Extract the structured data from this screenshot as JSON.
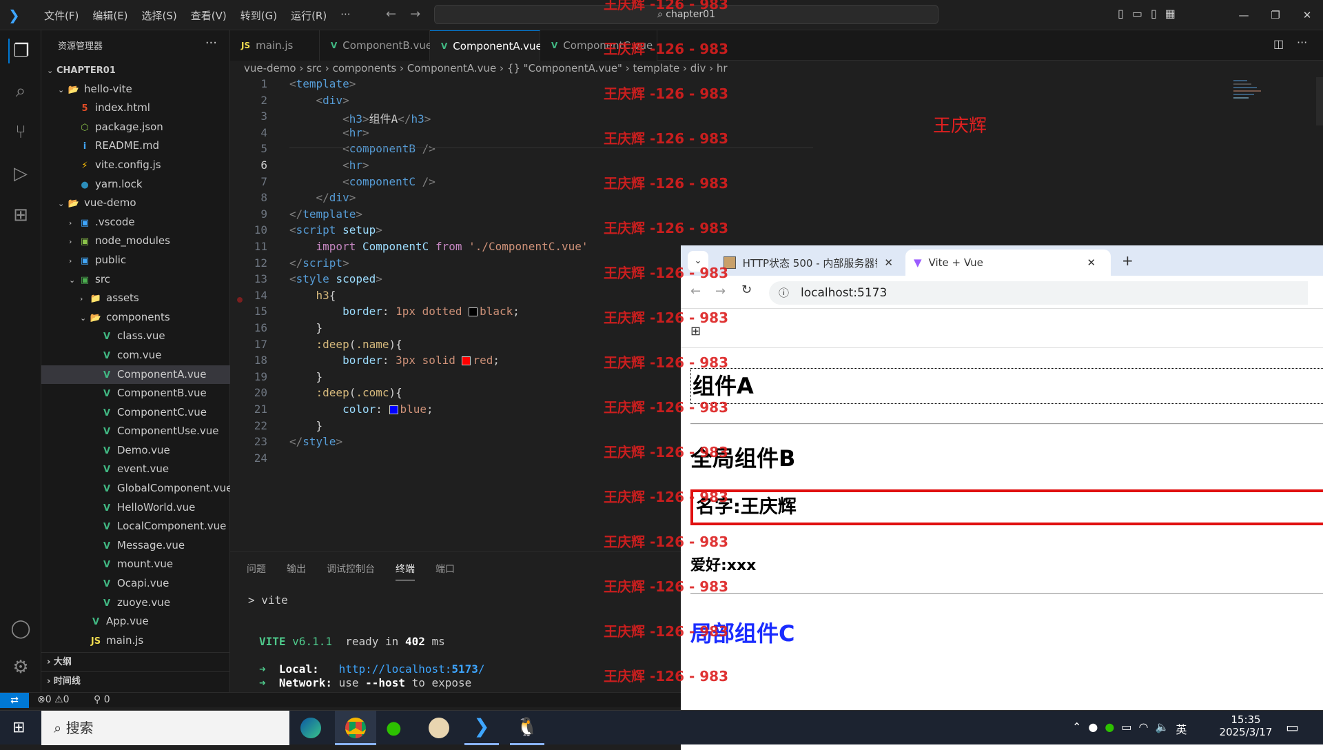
{
  "titlebar": {
    "menu": [
      "文件(F)",
      "编辑(E)",
      "选择(S)",
      "查看(V)",
      "转到(G)",
      "运行(R)",
      "···"
    ],
    "search": "chapter01"
  },
  "sidebar": {
    "title": "资源管理器",
    "outline": "大纲",
    "timeline": "时间线",
    "tree": [
      {
        "depth": 0,
        "arrow": "v",
        "icon": "",
        "label": "CHAPTER01",
        "bold": true
      },
      {
        "depth": 1,
        "arrow": "v",
        "icon": "folder-open-icon",
        "label": "hello-vite"
      },
      {
        "depth": 2,
        "arrow": "",
        "icon": "html-icon",
        "label": "index.html"
      },
      {
        "depth": 2,
        "arrow": "",
        "icon": "json-icon",
        "label": "package.json"
      },
      {
        "depth": 2,
        "arrow": "",
        "icon": "info-icon",
        "label": "README.md"
      },
      {
        "depth": 2,
        "arrow": "",
        "icon": "vite-icon",
        "label": "vite.config.js"
      },
      {
        "depth": 2,
        "arrow": "",
        "icon": "yarn-icon",
        "label": "yarn.lock"
      },
      {
        "depth": 1,
        "arrow": "v",
        "icon": "folder-open-icon",
        "label": "vue-demo"
      },
      {
        "depth": 2,
        "arrow": ">",
        "icon": "folder-vscode-icon",
        "label": ".vscode"
      },
      {
        "depth": 2,
        "arrow": ">",
        "icon": "folder-node-icon",
        "label": "node_modules"
      },
      {
        "depth": 2,
        "arrow": ">",
        "icon": "folder-public-icon",
        "label": "public"
      },
      {
        "depth": 2,
        "arrow": "v",
        "icon": "folder-src-icon",
        "label": "src"
      },
      {
        "depth": 3,
        "arrow": ">",
        "icon": "folder-icon",
        "label": "assets"
      },
      {
        "depth": 3,
        "arrow": "v",
        "icon": "folder-open-icon",
        "label": "components"
      },
      {
        "depth": 4,
        "arrow": "",
        "icon": "vue-icon",
        "label": "class.vue"
      },
      {
        "depth": 4,
        "arrow": "",
        "icon": "vue-icon",
        "label": "com.vue"
      },
      {
        "depth": 4,
        "arrow": "",
        "icon": "vue-icon",
        "label": "ComponentA.vue",
        "selected": true
      },
      {
        "depth": 4,
        "arrow": "",
        "icon": "vue-icon",
        "label": "ComponentB.vue"
      },
      {
        "depth": 4,
        "arrow": "",
        "icon": "vue-icon",
        "label": "ComponentC.vue"
      },
      {
        "depth": 4,
        "arrow": "",
        "icon": "vue-icon",
        "label": "ComponentUse.vue"
      },
      {
        "depth": 4,
        "arrow": "",
        "icon": "vue-icon",
        "label": "Demo.vue"
      },
      {
        "depth": 4,
        "arrow": "",
        "icon": "vue-icon",
        "label": "event.vue"
      },
      {
        "depth": 4,
        "arrow": "",
        "icon": "vue-icon",
        "label": "GlobalComponent.vue"
      },
      {
        "depth": 4,
        "arrow": "",
        "icon": "vue-icon",
        "label": "HelloWorld.vue"
      },
      {
        "depth": 4,
        "arrow": "",
        "icon": "vue-icon",
        "label": "LocalComponent.vue"
      },
      {
        "depth": 4,
        "arrow": "",
        "icon": "vue-icon",
        "label": "Message.vue"
      },
      {
        "depth": 4,
        "arrow": "",
        "icon": "vue-icon",
        "label": "mount.vue"
      },
      {
        "depth": 4,
        "arrow": "",
        "icon": "vue-icon",
        "label": "Ocapi.vue"
      },
      {
        "depth": 4,
        "arrow": "",
        "icon": "vue-icon",
        "label": "zuoye.vue"
      },
      {
        "depth": 3,
        "arrow": "",
        "icon": "vue-icon",
        "label": "App.vue"
      },
      {
        "depth": 3,
        "arrow": "",
        "icon": "js-icon",
        "label": "main.js"
      }
    ]
  },
  "tabs": [
    {
      "icon": "js-icon",
      "label": "main.js",
      "active": false
    },
    {
      "icon": "vue-icon",
      "label": "ComponentB.vue",
      "active": false
    },
    {
      "icon": "vue-icon",
      "label": "ComponentA.vue",
      "active": true,
      "close": "×"
    },
    {
      "icon": "vue-icon",
      "label": "ComponentC.vue",
      "active": false
    }
  ],
  "breadcrumb": [
    "vue-demo",
    "src",
    "components",
    "ComponentA.vue",
    "{} \"ComponentA.vue\"",
    "template",
    "div",
    "hr"
  ],
  "code": [
    [
      [
        "t-tag",
        "<"
      ],
      [
        "t-n",
        "template"
      ],
      [
        "t-tag",
        ">"
      ]
    ],
    [
      [
        "t-t",
        "    "
      ],
      [
        "t-tag",
        "<"
      ],
      [
        "t-n",
        "div"
      ],
      [
        "t-tag",
        ">"
      ]
    ],
    [
      [
        "t-t",
        "        "
      ],
      [
        "t-tag",
        "<"
      ],
      [
        "t-n",
        "h3"
      ],
      [
        "t-tag",
        ">"
      ],
      [
        "t-t",
        "组件A"
      ],
      [
        "t-tag",
        "</"
      ],
      [
        "t-n",
        "h3"
      ],
      [
        "t-tag",
        ">"
      ]
    ],
    [
      [
        "t-t",
        "        "
      ],
      [
        "t-tag",
        "<"
      ],
      [
        "t-n",
        "hr"
      ],
      [
        "t-tag",
        ">"
      ]
    ],
    [
      [
        "t-t",
        "        "
      ],
      [
        "t-tag",
        "<"
      ],
      [
        "t-n",
        "componentB"
      ],
      [
        "t-tag",
        " />"
      ]
    ],
    [
      [
        "t-t",
        "        "
      ],
      [
        "t-tag",
        "<"
      ],
      [
        "t-n",
        "hr"
      ],
      [
        "t-tag",
        ">"
      ]
    ],
    [
      [
        "t-t",
        "        "
      ],
      [
        "t-tag",
        "<"
      ],
      [
        "t-n",
        "componentC"
      ],
      [
        "t-tag",
        " />"
      ]
    ],
    [
      [
        "t-t",
        "    "
      ],
      [
        "t-tag",
        "</"
      ],
      [
        "t-n",
        "div"
      ],
      [
        "t-tag",
        ">"
      ]
    ],
    [
      [
        "t-tag",
        "</"
      ],
      [
        "t-n",
        "template"
      ],
      [
        "t-tag",
        ">"
      ]
    ],
    [
      [
        "t-tag",
        "<"
      ],
      [
        "t-n",
        "script"
      ],
      [
        "t-t",
        " "
      ],
      [
        "t-a",
        "setup"
      ],
      [
        "t-tag",
        ">"
      ]
    ],
    [
      [
        "t-t",
        "    "
      ],
      [
        "t-k",
        "import"
      ],
      [
        "t-t",
        " "
      ],
      [
        "t-a",
        "ComponentC"
      ],
      [
        "t-t",
        " "
      ],
      [
        "t-k",
        "from"
      ],
      [
        "t-t",
        " "
      ],
      [
        "t-s",
        "'./ComponentC.vue'"
      ]
    ],
    [
      [
        "t-tag",
        "</"
      ],
      [
        "t-n",
        "script"
      ],
      [
        "t-tag",
        ">"
      ]
    ],
    [
      [
        "t-tag",
        "<"
      ],
      [
        "t-n",
        "style"
      ],
      [
        "t-t",
        " "
      ],
      [
        "t-a",
        "scoped"
      ],
      [
        "t-tag",
        ">"
      ]
    ],
    [
      [
        "t-t",
        "    "
      ],
      [
        "t-y",
        "h3"
      ],
      [
        "t-t",
        "{"
      ]
    ],
    [
      [
        "t-t",
        "        "
      ],
      [
        "t-a",
        "border"
      ],
      [
        "t-t",
        ": "
      ],
      [
        "t-s",
        "1px"
      ],
      [
        "t-t",
        " "
      ],
      [
        "t-s",
        "dotted"
      ],
      [
        "t-t",
        " "
      ],
      [
        "sw",
        "#000000"
      ],
      [
        "t-s",
        "black"
      ],
      [
        "t-t",
        ";"
      ]
    ],
    [
      [
        "t-t",
        "    }"
      ]
    ],
    [
      [
        "t-t",
        "    "
      ],
      [
        "t-y",
        ":deep"
      ],
      [
        "t-t",
        "("
      ],
      [
        "t-y",
        ".name"
      ],
      [
        "t-t",
        "){"
      ]
    ],
    [
      [
        "t-t",
        "        "
      ],
      [
        "t-a",
        "border"
      ],
      [
        "t-t",
        ": "
      ],
      [
        "t-s",
        "3px"
      ],
      [
        "t-t",
        " "
      ],
      [
        "t-s",
        "solid"
      ],
      [
        "t-t",
        " "
      ],
      [
        "sw",
        "#ff0000"
      ],
      [
        "t-s",
        "red"
      ],
      [
        "t-t",
        ";"
      ]
    ],
    [
      [
        "t-t",
        "    }"
      ]
    ],
    [
      [
        "t-t",
        "    "
      ],
      [
        "t-y",
        ":deep"
      ],
      [
        "t-t",
        "("
      ],
      [
        "t-y",
        ".comc"
      ],
      [
        "t-t",
        "){"
      ]
    ],
    [
      [
        "t-t",
        "        "
      ],
      [
        "t-a",
        "color"
      ],
      [
        "t-t",
        ": "
      ],
      [
        "sw",
        "#0000ff"
      ],
      [
        "t-s",
        "blue"
      ],
      [
        "t-t",
        ";"
      ]
    ],
    [
      [
        "t-t",
        "    }"
      ]
    ],
    [
      [
        "t-tag",
        "</"
      ],
      [
        "t-n",
        "style"
      ],
      [
        "t-tag",
        ">"
      ]
    ],
    [
      [
        "t-t",
        ""
      ]
    ]
  ],
  "editor_overlay": "王庆辉",
  "panel": {
    "tabs": [
      "问题",
      "输出",
      "调试控制台",
      "终端",
      "端口"
    ],
    "active_tab": "终端",
    "prompt": "> vite",
    "vite_name": "VITE",
    "vite_version": "v6.1.1",
    "ready": "ready in",
    "ready_ms": "402",
    "ms": "ms",
    "local_label": "Local:",
    "local_url_a": "http://localhost:",
    "local_port": "5173",
    "local_url_b": "/",
    "network_label": "Network:",
    "network_text_a": "use",
    "network_flag": "--host",
    "network_text_b": "to expose"
  },
  "status": {
    "errors": "0",
    "warnings": "0",
    "ports": "0"
  },
  "browser": {
    "tabs": [
      {
        "label": "HTTP状态 500 - 内部服务器错",
        "active": false
      },
      {
        "label": "Vite + Vue",
        "active": true
      }
    ],
    "url": "localhost:5173",
    "page": {
      "h3": "组件A",
      "b_title": "全局组件B",
      "name": "名字:王庆辉",
      "hobby": "爱好:xxx",
      "c_title": "局部组件C"
    }
  },
  "watermark": "王庆辉 -126 - 983",
  "taskbar": {
    "search": "搜索",
    "time": "15:35",
    "date": "2025/3/17",
    "ime": "英"
  }
}
